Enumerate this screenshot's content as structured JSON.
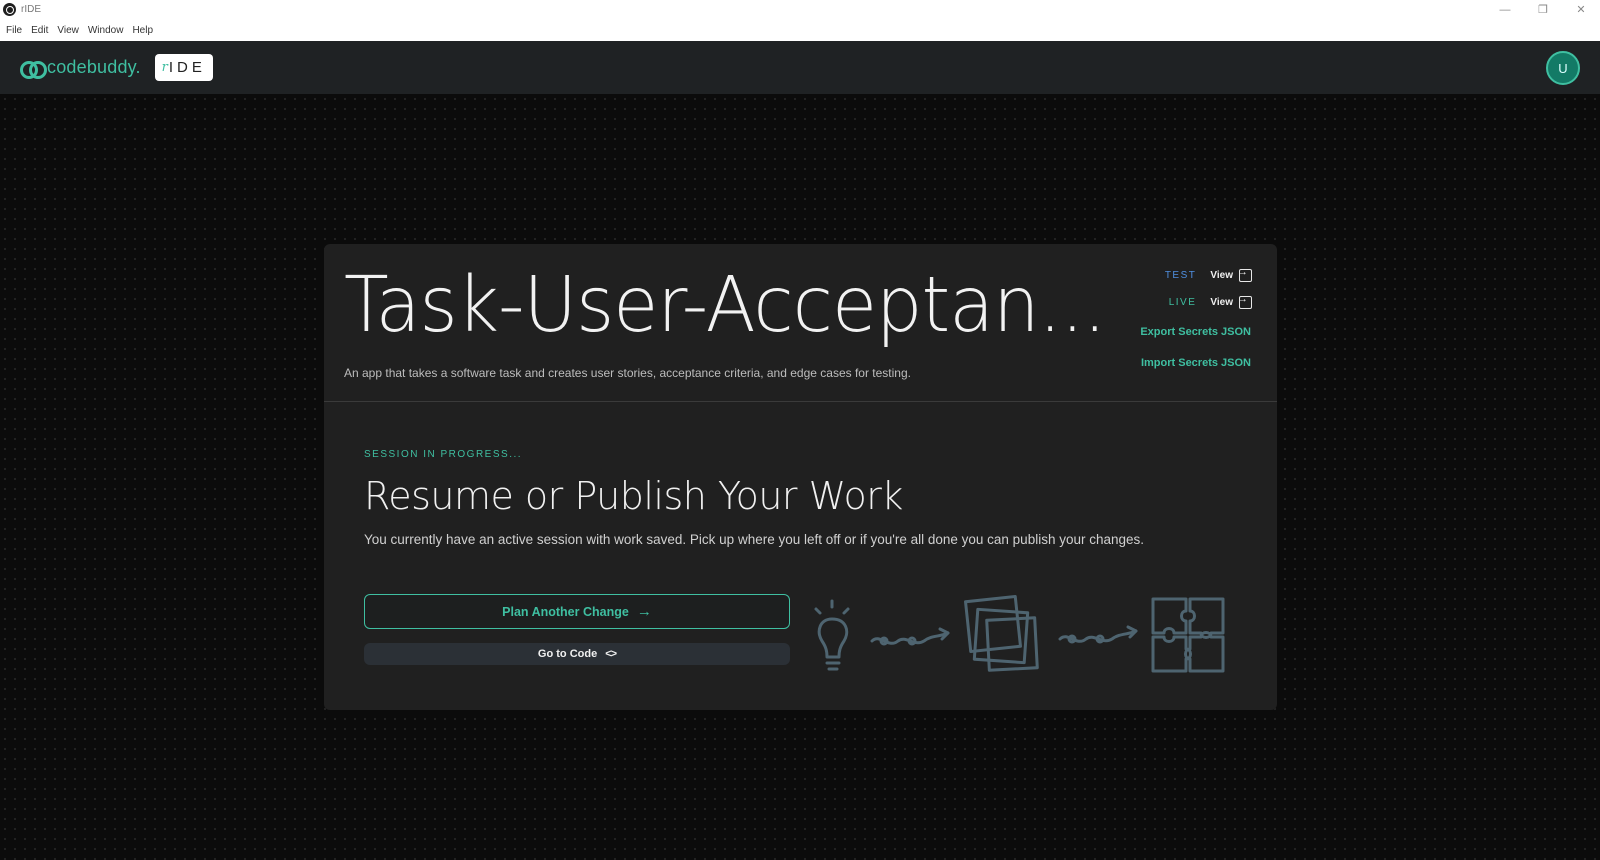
{
  "window": {
    "title": "rIDE",
    "controls": {
      "minimize": "—",
      "restore": "❐",
      "close": "✕"
    }
  },
  "menu": {
    "items": [
      "File",
      "Edit",
      "View",
      "Window",
      "Help"
    ]
  },
  "header": {
    "brand": "codebuddy.",
    "badge_r": "r",
    "badge_text": "IDE",
    "avatar_initial": "U"
  },
  "project": {
    "title": "Task-User-Acceptan...",
    "description": "An app that takes a software task and creates user stories, acceptance criteria, and edge cases for testing."
  },
  "environments": {
    "test": {
      "label": "TEST",
      "link": "View",
      "color": "#4f8fe0"
    },
    "live": {
      "label": "LIVE",
      "link": "View",
      "color": "#3fbfa1"
    }
  },
  "secrets": {
    "export_label": "Export Secrets JSON",
    "import_label": "Import Secrets JSON"
  },
  "session": {
    "status": "SESSION IN PROGRESS...",
    "title": "Resume or Publish Your Work",
    "description": "You currently have an active session with work saved. Pick up where you left off or if you're all done you can publish your changes.",
    "plan_button": "Plan Another Change",
    "code_button": "Go to Code"
  },
  "colors": {
    "accent": "#3fbfa1",
    "card_bg": "#202020",
    "page_bg": "#0b0b0b",
    "illustration_stroke": "#4e6470"
  }
}
